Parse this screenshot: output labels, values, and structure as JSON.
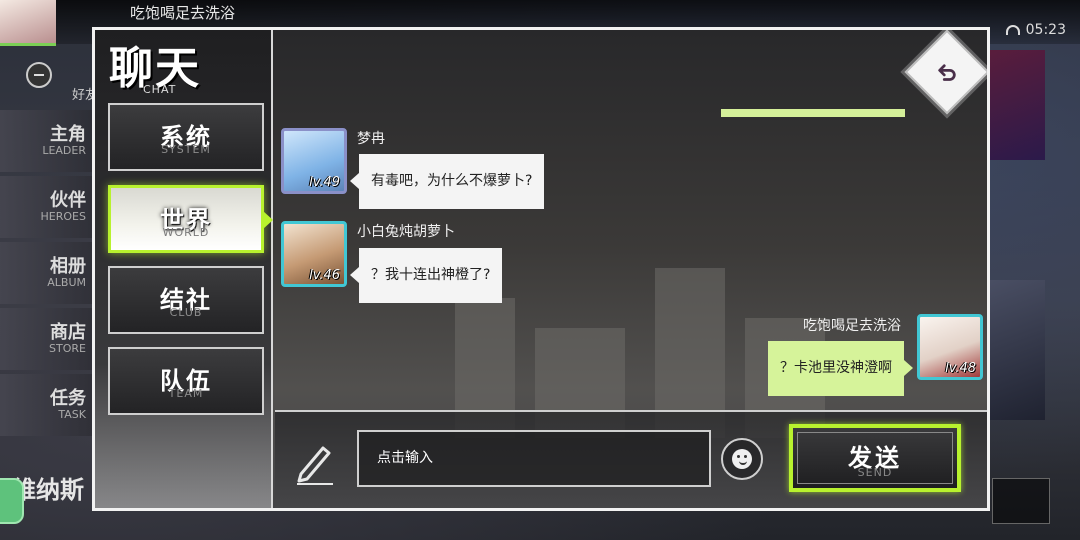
{
  "background": {
    "player_name": "吃饱喝足去洗浴",
    "time": "05:23",
    "friends_label": "好友",
    "menu": [
      {
        "cn": "主角",
        "en": "LEADER"
      },
      {
        "cn": "伙伴",
        "en": "HEROES"
      },
      {
        "cn": "相册",
        "en": "ALBUM"
      },
      {
        "cn": "商店",
        "en": "STORE"
      },
      {
        "cn": "任务",
        "en": "TASK"
      }
    ],
    "bottom_text": "维纳斯"
  },
  "panel": {
    "title": "聊天",
    "title_en": "CHAT",
    "tabs": [
      {
        "cn": "系统",
        "en": "SYSTEM"
      },
      {
        "cn": "世界",
        "en": "WORLD"
      },
      {
        "cn": "结社",
        "en": "CLUB"
      },
      {
        "cn": "队伍",
        "en": "TEAM"
      }
    ],
    "active_tab": "世界",
    "accent_color": "#b8f22e"
  },
  "messages": [
    {
      "nick": "梦冉",
      "level": "lv.49",
      "text": "有毒吧，为什么不爆萝卜?",
      "side": "left",
      "avatar_color": "#9ec8ee"
    },
    {
      "nick": "小白兔炖胡萝卜",
      "level": "lv.46",
      "text": "？我十连出神橙了?",
      "side": "left",
      "avatar_color": "#c9a27e"
    },
    {
      "nick": "吃饱喝足去洗浴",
      "level": "lv.48",
      "text": "？卡池里没神澄啊",
      "side": "right",
      "avatar_color": "#efe6e0"
    }
  ],
  "input": {
    "placeholder": "点击输入",
    "send_label": "发送",
    "send_label_en": "SEND"
  },
  "icons": {
    "back": "back-arrow-icon",
    "pencil": "pencil-icon",
    "emoji": "emoji-icon"
  }
}
